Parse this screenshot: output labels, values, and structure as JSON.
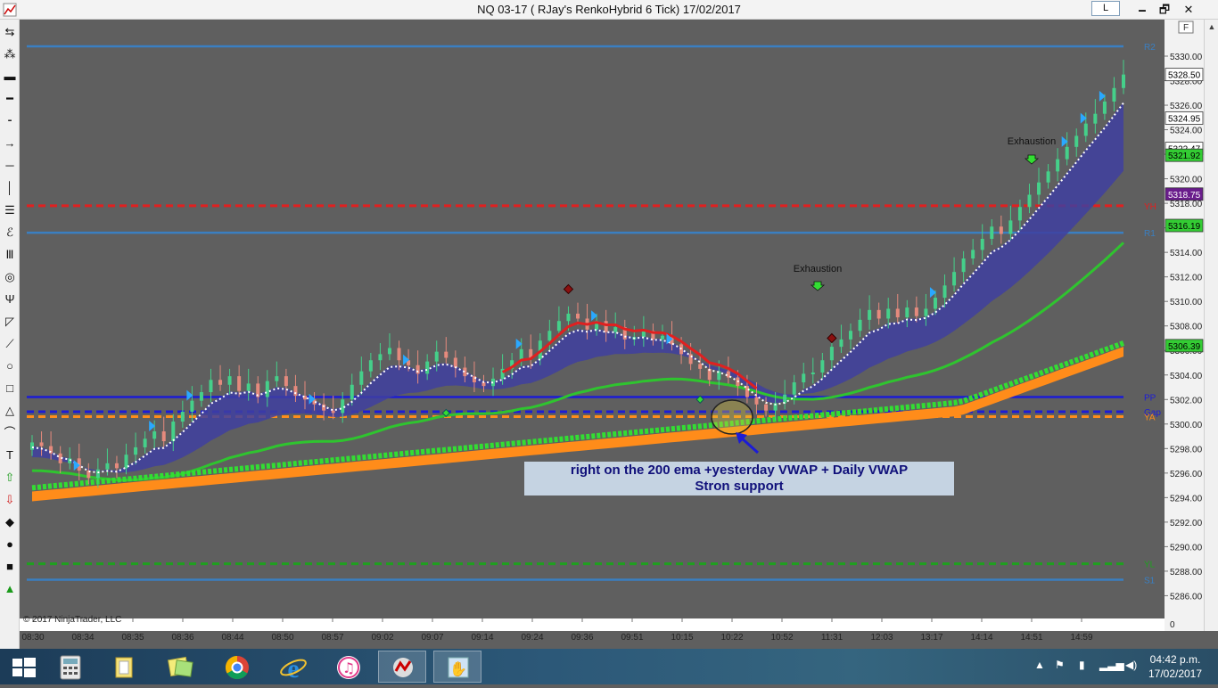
{
  "window": {
    "title": "NQ 03-17 ( RJay's RenkoHybrid  6 Tick)  17/02/2017",
    "layout_button": "L",
    "minimize_glyph": "🗕",
    "maximize_glyph": "🗗",
    "close_glyph": "✕"
  },
  "toolbar": {
    "tools": [
      "arrows-icon",
      "cursor-icon",
      "ruler-icon",
      "ray-icon",
      "extended-line-icon",
      "arrow-line-icon",
      "horizontal-line-icon",
      "vertical-line-icon",
      "fib-retracement-icon",
      "fib-extension-icon",
      "fib-time-icon",
      "fib-circle-icon",
      "andrews-pitchfork-icon",
      "gann-fan-icon",
      "regression-channel-icon",
      "ellipse-icon",
      "rectangle-icon",
      "triangle-icon",
      "arc-icon",
      "text-icon",
      "arrow-up-icon",
      "arrow-down-icon",
      "diamond-icon",
      "dot-icon",
      "square-icon",
      "triangle-up-icon"
    ]
  },
  "chart_data": {
    "type": "candlestick",
    "title": "",
    "ylim": [
      5284,
      5331
    ],
    "yticks": [
      "5330.00",
      "5328.00",
      "5326.00",
      "5324.00",
      "5322.00",
      "5320.00",
      "5318.00",
      "5316.00",
      "5314.00",
      "5312.00",
      "5310.00",
      "5308.00",
      "5306.00",
      "5304.00",
      "5302.00",
      "5300.00",
      "5298.00",
      "5296.00",
      "5294.00",
      "5292.00",
      "5290.00",
      "5288.00",
      "5286.00"
    ],
    "bottom_tick": "0",
    "xticks": [
      "08:30",
      "08:34",
      "08:35",
      "08:36",
      "08:44",
      "08:50",
      "08:57",
      "09:02",
      "09:07",
      "09:14",
      "09:24",
      "09:36",
      "09:51",
      "10:15",
      "10:22",
      "10:52",
      "11:31",
      "12:03",
      "13:17",
      "14:14",
      "14:51",
      "14:59"
    ],
    "price_levels": [
      {
        "label": "R2",
        "value": 5330.8,
        "color": "#3a7fc1",
        "style": "solid"
      },
      {
        "label": "YH",
        "value": 5317.8,
        "color": "#e02020",
        "style": "dashed"
      },
      {
        "label": "R1",
        "value": 5315.6,
        "color": "#3a7fc1",
        "style": "solid"
      },
      {
        "label": "PP",
        "value": 5302.2,
        "color": "#1c1cd6",
        "style": "solid"
      },
      {
        "label": "Gap",
        "value": 5301.0,
        "color": "#1c1cd6",
        "style": "dashed"
      },
      {
        "label": "YA",
        "value": 5300.6,
        "color": "#ff8c1a",
        "style": "dashed"
      },
      {
        "label": "YL",
        "value": 5288.6,
        "color": "#1fa01f",
        "style": "dashed"
      },
      {
        "label": "S1",
        "value": 5287.3,
        "color": "#3a7fc1",
        "style": "solid"
      }
    ],
    "price_markers": [
      {
        "text": "5328.50",
        "value": 5328.5,
        "bg": "#ffffff",
        "fg": "#000000"
      },
      {
        "text": "5324.95",
        "value": 5324.95,
        "bg": "#ffffff",
        "fg": "#000000"
      },
      {
        "text": "5322.47",
        "value": 5322.47,
        "bg": "#ffffff",
        "fg": "#000000"
      },
      {
        "text": "5321.92",
        "value": 5321.92,
        "bg": "#33cc33",
        "fg": "#000000"
      },
      {
        "text": "5318.75",
        "value": 5318.75,
        "bg": "#6a1d8c",
        "fg": "#ffffff"
      },
      {
        "text": "5316.19",
        "value": 5316.19,
        "bg": "#33cc33",
        "fg": "#000000"
      },
      {
        "text": "5306.39",
        "value": 5306.39,
        "bg": "#33cc33",
        "fg": "#000000"
      }
    ],
    "annotations": {
      "exhaustion_1": "Exhaustion",
      "exhaustion_2": "Exhaustion",
      "note_line1": "right on the 200  ema +yesterday VWAP + Daily VWAP",
      "note_line2": "Stron support",
      "copyright": "© 2017 NinjaTrader, LLC"
    },
    "colors": {
      "up_candle": "#45d08a",
      "down_candle": "#e58a7d",
      "ema200": "#33dd33",
      "vwap_band": "#ff8c1a",
      "cloud": "#3f3fa0",
      "trend_line": "#2fc42f",
      "hma_dotted": "#ffffff",
      "red_line": "#e02020"
    },
    "closes": [
      5298.5,
      5298.2,
      5297.6,
      5296.8,
      5297.2,
      5296.2,
      5295.6,
      5296.3,
      5296.8,
      5296.4,
      5297.5,
      5298.1,
      5298.8,
      5299.4,
      5298.6,
      5300.2,
      5301.0,
      5301.9,
      5302.6,
      5303.6,
      5303.2,
      5303.9,
      5302.7,
      5303.3,
      5302.2,
      5303.5,
      5303.9,
      5303.1,
      5302.3,
      5302.0,
      5301.6,
      5301.1,
      5300.9,
      5302.0,
      5303.2,
      5304.3,
      5305.2,
      5305.7,
      5306.2,
      5305.2,
      5304.8,
      5304.1,
      5305.1,
      5305.9,
      5305.4,
      5304.6,
      5303.9,
      5303.4,
      5303.1,
      5303.7,
      5304.5,
      5305.2,
      5306.1,
      5305.3,
      5306.8,
      5307.6,
      5308.4,
      5309.0,
      5308.6,
      5307.7,
      5308.4,
      5307.5,
      5307.9,
      5306.9,
      5307.1,
      5307.6,
      5306.9,
      5307.2,
      5306.5,
      5305.7,
      5304.9,
      5304.5,
      5303.6,
      5304.3,
      5303.8,
      5303.1,
      5302.2,
      5301.6,
      5301.1,
      5301.7,
      5302.4,
      5303.4,
      5304.1,
      5304.2,
      5305.2,
      5306.3,
      5306.9,
      5307.6,
      5308.5,
      5309.3,
      5308.6,
      5309.4,
      5308.7,
      5309.5,
      5308.8,
      5309.4,
      5310.3,
      5311.3,
      5312.4,
      5313.5,
      5314.2,
      5315.1,
      5316.1,
      5315.5,
      5316.6,
      5317.7,
      5318.7,
      5319.7,
      5320.6,
      5321.6,
      5322.6,
      5323.5,
      5324.5,
      5325.3,
      5326.3,
      5327.4,
      5328.5
    ]
  },
  "taskbar": {
    "pinned": [
      "windows-start-icon",
      "calculator-icon",
      "file-explorer-icon",
      "sticky-notes-icon",
      "chrome-icon",
      "internet-explorer-icon",
      "itunes-icon",
      "ninjatrader-icon",
      "hand-tool-icon"
    ],
    "clock_time": "04:42 p.m.",
    "clock_date": "17/02/2017"
  }
}
